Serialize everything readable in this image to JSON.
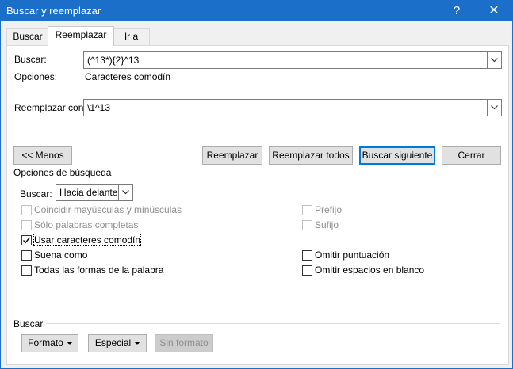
{
  "window": {
    "title": "Buscar y reemplazar",
    "help": "?",
    "close": "✕"
  },
  "tabs": [
    {
      "label": "Buscar"
    },
    {
      "label": "Reemplazar"
    },
    {
      "label": "Ir a"
    }
  ],
  "find": {
    "label": "Buscar:",
    "value": "(^13*){2}^13"
  },
  "options_row": {
    "label": "Opciones:",
    "value": "Caracteres comodín"
  },
  "replace": {
    "label": "Reemplazar con:",
    "value": "\\1^13"
  },
  "buttons": {
    "less": "<< Menos",
    "replace": "Reemplazar",
    "replace_all": "Reemplazar todos",
    "find_next": "Buscar siguiente",
    "close": "Cerrar"
  },
  "search_options": {
    "title": "Opciones de búsqueda",
    "direction_label": "Buscar:",
    "direction_value": "Hacia delante",
    "match_case": "Coincidir mayúsculas y minúsculas",
    "whole_words": "Sólo palabras completas",
    "wildcards": "Usar caracteres comodín",
    "sounds_like": "Suena como",
    "all_forms": "Todas las formas de la palabra",
    "prefix": "Prefijo",
    "suffix": "Sufijo",
    "ignore_punct": "Omitir puntuación",
    "ignore_space": "Omitir espacios en blanco"
  },
  "bottom": {
    "title": "Buscar",
    "format": "Formato",
    "special": "Especial",
    "no_format": "Sin formato"
  }
}
